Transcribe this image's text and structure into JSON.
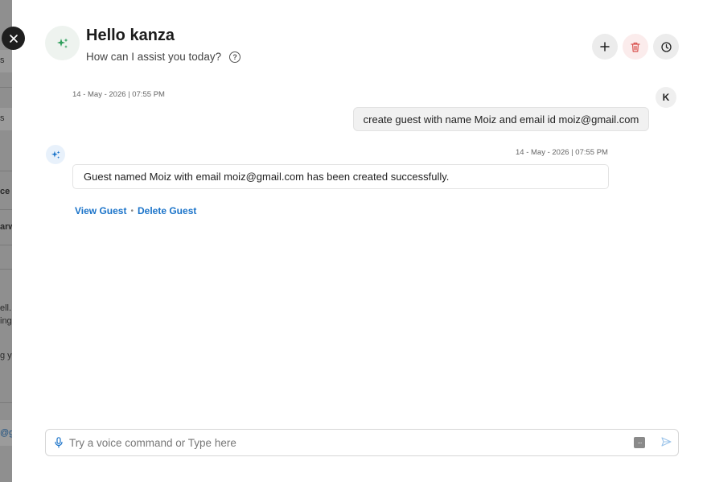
{
  "background_fragments": [
    {
      "text": "s"
    },
    {
      "text": "s"
    },
    {
      "text": "ce"
    },
    {
      "text": "arw"
    },
    {
      "text": "ell."
    },
    {
      "text": "ing"
    },
    {
      "text": "g y"
    },
    {
      "text": "@g"
    }
  ],
  "header": {
    "greeting": "Hello kanza",
    "subtitle": "How can I assist you today?",
    "help_icon_glyph": "?"
  },
  "messages": {
    "user": {
      "avatar_initial": "K",
      "timestamp": "14 - May - 2026 | 07:55 PM",
      "text": "create guest with name Moiz and email id moiz@gmail.com"
    },
    "assistant": {
      "timestamp": "14 - May - 2026 | 07:55 PM",
      "text": "Guest named Moiz with email moiz@gmail.com has been created successfully.",
      "actions": [
        {
          "label": "View Guest"
        },
        {
          "label": "Delete Guest"
        }
      ],
      "separator": "•"
    }
  },
  "input": {
    "placeholder": "Try a voice command or Type here",
    "value": "",
    "keyboard_glyph": "···"
  },
  "colors": {
    "accent_blue": "#1a73c9",
    "assistant_green": "#2e9e5b",
    "delete_red": "#d9534f"
  },
  "icons": {
    "close": "close-icon",
    "new_chat": "plus-icon",
    "delete_chat": "trash-icon",
    "history": "clock-icon",
    "mic": "mic-icon",
    "keyboard": "keyboard-icon",
    "send": "send-icon",
    "assistant": "sparkle-icon"
  }
}
